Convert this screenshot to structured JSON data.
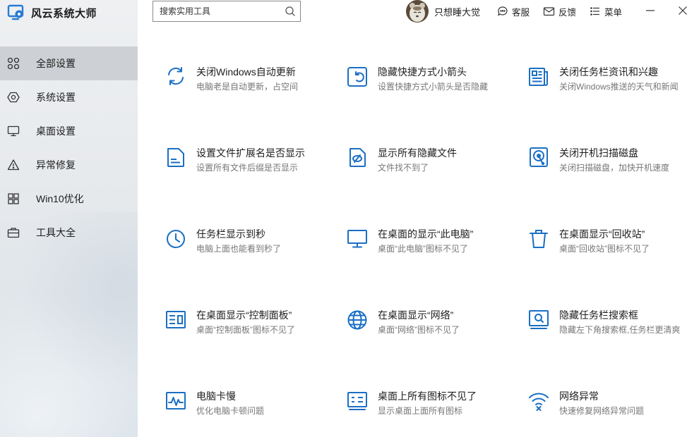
{
  "app": {
    "title": "风云系统大师"
  },
  "search": {
    "placeholder": "搜索实用工具"
  },
  "user": {
    "name": "只想睡大觉"
  },
  "top_actions": {
    "service": "客服",
    "feedback": "反馈",
    "menu": "菜单"
  },
  "sidebar": {
    "items": [
      {
        "label": "全部设置",
        "icon": "grid-icon",
        "active": true
      },
      {
        "label": "系统设置",
        "icon": "gear-icon"
      },
      {
        "label": "桌面设置",
        "icon": "monitor-icon"
      },
      {
        "label": "异常修复",
        "icon": "warning-icon"
      },
      {
        "label": "Win10优化",
        "icon": "windows-icon"
      },
      {
        "label": "工具大全",
        "icon": "toolbox-icon"
      }
    ]
  },
  "tools": [
    {
      "title": "关闭Windows自动更新",
      "desc": "电脑老是自动更新，占空间",
      "icon": "refresh-icon"
    },
    {
      "title": "隐藏快捷方式小箭头",
      "desc": "设置快捷方式小箭头是否隐藏",
      "icon": "shortcut-arrow-icon"
    },
    {
      "title": "关闭任务栏资讯和兴趣",
      "desc": "关闭Windows推送的天气和新闻",
      "icon": "news-icon"
    },
    {
      "title": "设置文件扩展名是否显示",
      "desc": "设置所有文件后缀是否显示",
      "icon": "file-icon"
    },
    {
      "title": "显示所有隐藏文件",
      "desc": "文件找不到了",
      "icon": "hidden-file-icon"
    },
    {
      "title": "关闭开机扫描磁盘",
      "desc": "关闭扫描磁盘，加快开机速度",
      "icon": "disk-scan-icon"
    },
    {
      "title": "任务栏显示到秒",
      "desc": "电脑上面也能看到秒了",
      "icon": "clock-icon"
    },
    {
      "title": "在桌面的显示“此电脑”",
      "desc": "桌面“此电脑”图标不见了",
      "icon": "computer-icon"
    },
    {
      "title": "在桌面显示“回收站”",
      "desc": "桌面“回收站”图标不见了",
      "icon": "recycle-bin-icon"
    },
    {
      "title": "在桌面显示“控制面板”",
      "desc": "桌面“控制面板”图标不见了",
      "icon": "control-panel-icon"
    },
    {
      "title": "在桌面显示“网络”",
      "desc": "桌面“网络”图标不见了",
      "icon": "globe-icon"
    },
    {
      "title": "隐藏任务栏搜索框",
      "desc": "隐藏左下角搜索框,任务栏更清爽",
      "icon": "search-box-icon"
    },
    {
      "title": "电脑卡慢",
      "desc": "优化电脑卡顿问题",
      "icon": "performance-icon"
    },
    {
      "title": "桌面上所有图标不见了",
      "desc": "显示桌面上面所有图标",
      "icon": "desktop-icons-icon"
    },
    {
      "title": "网络异常",
      "desc": "快速修复网络异常问题",
      "icon": "wifi-error-icon"
    }
  ],
  "colors": {
    "accent": "#1a6fc4",
    "sidebar_active": "#cdd0d4"
  }
}
